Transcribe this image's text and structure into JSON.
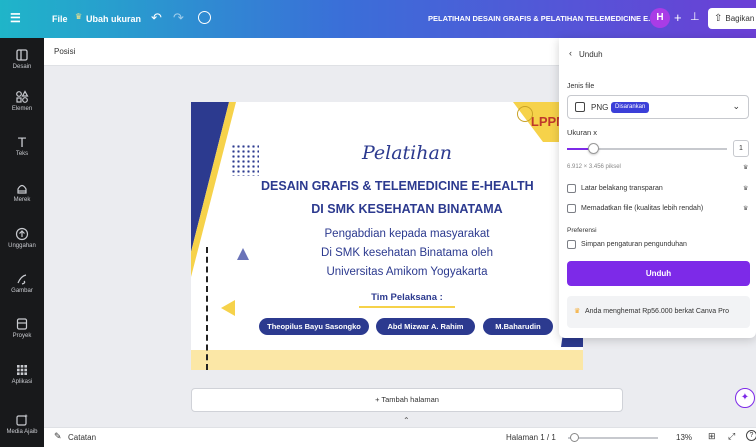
{
  "topbar": {
    "menu_icon": "☰",
    "file_label": "File",
    "resize_label": "Ubah ukuran",
    "title": "PELATIHAN DESAIN GRAFIS & PELATIHAN TELEMEDICINE E...",
    "avatar_initial": "H",
    "plus_label": "+",
    "share_label": "Bagikan"
  },
  "sidebar": {
    "items": [
      {
        "label": "Desain"
      },
      {
        "label": "Elemen"
      },
      {
        "label": "Teks"
      },
      {
        "label": "Merek"
      },
      {
        "label": "Unggahan"
      },
      {
        "label": "Gambar"
      },
      {
        "label": "Proyek"
      },
      {
        "label": "Aplikasi"
      },
      {
        "label": "Media Ajaib"
      }
    ]
  },
  "toolbar": {
    "posisi_label": "Posisi"
  },
  "slide": {
    "logo_text": "LPPM",
    "script_title": "Pelatihan",
    "title_line1": "DESAIN GRAFIS &  TELEMEDICINE E-HEALTH",
    "title_line2": "DI SMK KESEHATAN BINATAMA",
    "sub_line1": "Pengabdian kepada masyarakat",
    "sub_line2": "Di SMK kesehatan Binatama oleh",
    "sub_line3": "Universitas Amikom Yogyakarta",
    "team_label": "Tim Pelaksana :",
    "members": [
      "Theopilus Bayu Sasongko",
      "Abd Mizwar A. Rahim",
      "M.Baharudin"
    ],
    "colors": {
      "navy": "#2c3a8f",
      "yellow": "#f6d24a",
      "pale_yellow": "#fbe7a6"
    }
  },
  "add_page_label": "+ Tambah halaman",
  "bottom": {
    "notes_label": "Catatan",
    "page_label": "Halaman 1 / 1",
    "zoom": "13%"
  },
  "download_panel": {
    "back_label": "Unduh",
    "file_type_label": "Jenis file",
    "file_type_value": "PNG",
    "recommended_badge": "Disarankan",
    "size_label": "Ukuran x",
    "size_value": "1",
    "size_fraction": 0.16,
    "dimensions": "6.912 × 3.456 piksel",
    "transparent_label": "Latar belakang transparan",
    "compress_label": "Memadatkan file (kualitas lebih rendah)",
    "prefs_label": "Preferensi",
    "save_prefs_label": "Simpan pengaturan pengunduhan",
    "download_button": "Unduh",
    "pro_note": "Anda menghemat Rp56.000 berkat Canva Pro",
    "accent": "#7d2ae8"
  }
}
